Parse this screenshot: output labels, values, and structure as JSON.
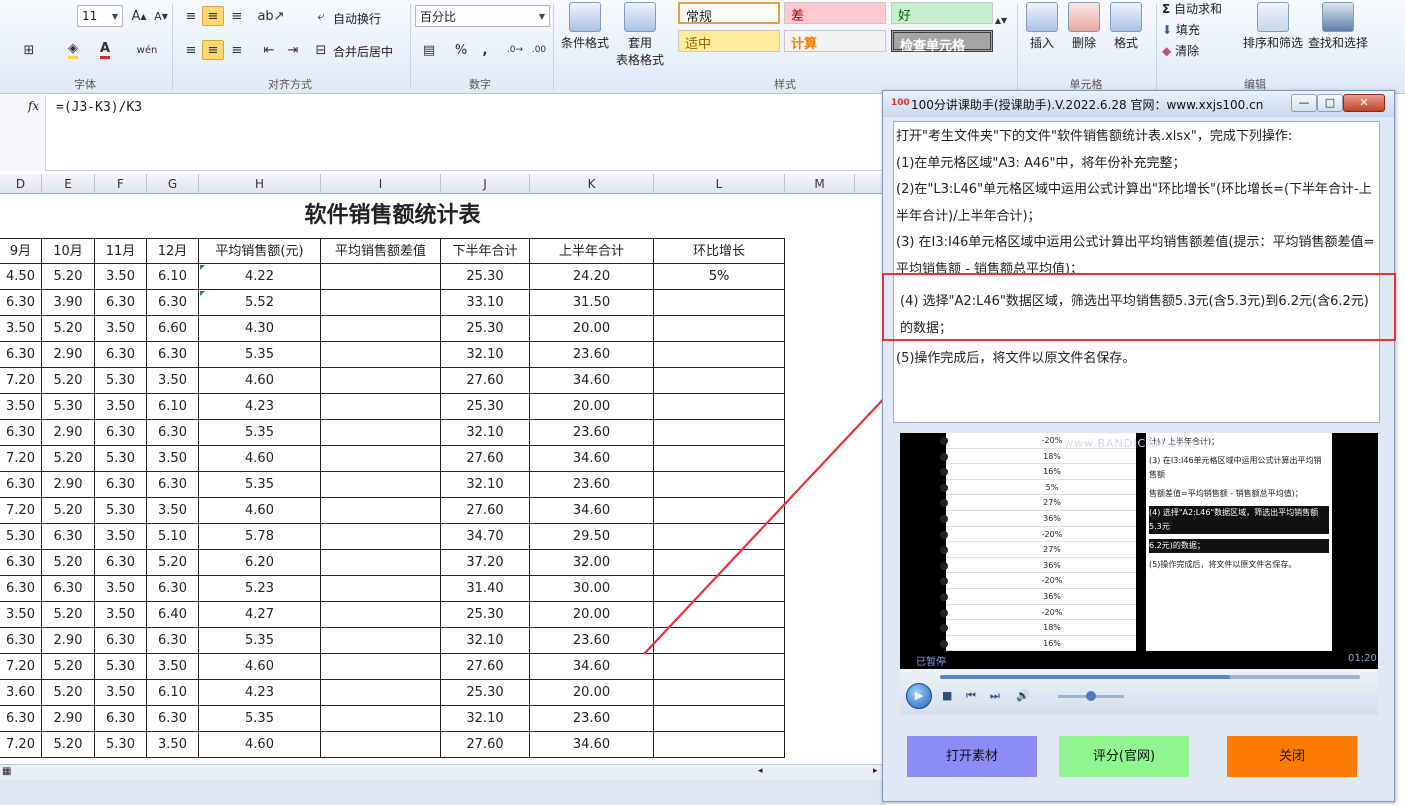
{
  "ribbon": {
    "font_size": "11",
    "font_color": "#e0242a",
    "fill_color": "#ffd23f",
    "wrap_label": "自动换行",
    "merge_label": "合并后居中",
    "number_format": "百分比",
    "percent_symbol": "%",
    "comma_symbol": ",",
    "cond_format_label": "条件格式",
    "table_format_label_1": "套用",
    "table_format_label_2": "表格格式",
    "styles": {
      "normal": "常规",
      "bad": "差",
      "good": "好",
      "neutral": "适中",
      "calc": "计算",
      "check": "检查单元格"
    },
    "insert_label": "插入",
    "delete_label": "删除",
    "format_label": "格式",
    "autosum_label": "自动求和",
    "fill_label": "填充",
    "clear_label": "清除",
    "sort_filter_label": "排序和筛选",
    "find_select_label": "查找和选择",
    "groups": {
      "font": "字体",
      "alignment": "对齐方式",
      "number": "数字",
      "styles": "样式",
      "cells": "单元格",
      "editing": "编辑"
    }
  },
  "formula_bar": {
    "fx": "fx",
    "formula": "=(J3-K3)/K3"
  },
  "sheet": {
    "columns": [
      {
        "letter": "D",
        "w": 42
      },
      {
        "letter": "E",
        "w": 53
      },
      {
        "letter": "F",
        "w": 52
      },
      {
        "letter": "G",
        "w": 52
      },
      {
        "letter": "H",
        "w": 122
      },
      {
        "letter": "I",
        "w": 120
      },
      {
        "letter": "J",
        "w": 89
      },
      {
        "letter": "K",
        "w": 124
      },
      {
        "letter": "L",
        "w": 131
      },
      {
        "letter": "M",
        "w": 70
      }
    ],
    "title": "软件销售额统计表",
    "headers": [
      "9月",
      "10月",
      "11月",
      "12月",
      "平均销售额(元)",
      "平均销售额差值",
      "下半年合计",
      "上半年合计",
      "环比增长"
    ],
    "rows": [
      [
        "4.50",
        "5.20",
        "3.50",
        "6.10",
        "4.22",
        "",
        "25.30",
        "24.20",
        "5%"
      ],
      [
        "6.30",
        "3.90",
        "6.30",
        "6.30",
        "5.52",
        "",
        "33.10",
        "31.50",
        ""
      ],
      [
        "3.50",
        "5.20",
        "3.50",
        "6.60",
        "4.30",
        "",
        "25.30",
        "20.00",
        ""
      ],
      [
        "6.30",
        "2.90",
        "6.30",
        "6.30",
        "5.35",
        "",
        "32.10",
        "23.60",
        ""
      ],
      [
        "7.20",
        "5.20",
        "5.30",
        "3.50",
        "4.60",
        "",
        "27.60",
        "34.60",
        ""
      ],
      [
        "3.50",
        "5.30",
        "3.50",
        "6.10",
        "4.23",
        "",
        "25.30",
        "20.00",
        ""
      ],
      [
        "6.30",
        "2.90",
        "6.30",
        "6.30",
        "5.35",
        "",
        "32.10",
        "23.60",
        ""
      ],
      [
        "7.20",
        "5.20",
        "5.30",
        "3.50",
        "4.60",
        "",
        "27.60",
        "34.60",
        ""
      ],
      [
        "6.30",
        "2.90",
        "6.30",
        "6.30",
        "5.35",
        "",
        "32.10",
        "23.60",
        ""
      ],
      [
        "7.20",
        "5.20",
        "5.30",
        "3.50",
        "4.60",
        "",
        "27.60",
        "34.60",
        ""
      ],
      [
        "5.30",
        "6.30",
        "3.50",
        "5.10",
        "5.78",
        "",
        "34.70",
        "29.50",
        ""
      ],
      [
        "6.30",
        "5.20",
        "6.30",
        "5.20",
        "6.20",
        "",
        "37.20",
        "32.00",
        ""
      ],
      [
        "6.30",
        "6.30",
        "3.50",
        "6.30",
        "5.23",
        "",
        "31.40",
        "30.00",
        ""
      ],
      [
        "3.50",
        "5.20",
        "3.50",
        "6.40",
        "4.27",
        "",
        "25.30",
        "20.00",
        ""
      ],
      [
        "6.30",
        "2.90",
        "6.30",
        "6.30",
        "5.35",
        "",
        "32.10",
        "23.60",
        ""
      ],
      [
        "7.20",
        "5.20",
        "5.30",
        "3.50",
        "4.60",
        "",
        "27.60",
        "34.60",
        ""
      ],
      [
        "3.60",
        "5.20",
        "3.50",
        "6.10",
        "4.23",
        "",
        "25.30",
        "20.00",
        ""
      ],
      [
        "6.30",
        "2.90",
        "6.30",
        "6.30",
        "5.35",
        "",
        "32.10",
        "23.60",
        ""
      ],
      [
        "7.20",
        "5.20",
        "5.30",
        "3.50",
        "4.60",
        "",
        "27.60",
        "34.60",
        ""
      ]
    ]
  },
  "helper": {
    "title": "100分讲课助手(授课助手).V.2022.6.28  官网：www.xxjs100.cn",
    "logo": "100",
    "paragraphs": [
      "打开\"考生文件夹\"下的文件\"软件销售额统计表.xlsx\"，完成下列操作:",
      "(1)在单元格区域\"A3: A46\"中，将年份补充完整；",
      "(2)在\"L3:L46\"单元格区域中运用公式计算出\"环比增长\"(环比增长=(下半年合计-上半年合计)/上半年合计)；",
      "(3) 在I3:I46单元格区域中运用公式计算出平均销售额差值(提示：平均销售额差值=平均销售额 - 销售额总平均值)；",
      "(4)  选择\"A2:L46\"数据区域，筛选出平均销售额5.3元(含5.3元)到6.2元(含6.2元)的数据；",
      "(5)操作完成后，将文件以原文件名保存。"
    ],
    "video": {
      "watermark": "www.BANDICAM.com",
      "left_values": [
        "-20%",
        "18%",
        "16%",
        "5%",
        "27%",
        "36%",
        "-20%",
        "27%",
        "36%",
        "-20%",
        "36%",
        "-20%",
        "18%",
        "16%"
      ],
      "right_lines": [
        "计) / 上半年合计)；",
        "(3) 在I3:I46单元格区域中运用公式计算出平均销售额",
        "售额差值=平均销售额 - 销售额总平均值)；",
        "(4) 选择\"A2:L46\"数据区域，筛选出平均销售额5.3元",
        "6.2元)的数据；",
        "(5)操作完成后，将文件以原文件名保存。"
      ],
      "status": "已暂停",
      "time": "01:20",
      "progress": 0.69,
      "volume": 0.5
    },
    "buttons": {
      "open": "打开素材",
      "score": "评分(官网)",
      "close": "关闭"
    },
    "colors": {
      "open_btn": "#8b8cf6",
      "score_btn": "#8ff58f",
      "close_btn": "#ff7b00",
      "highlight": "#e8323c"
    }
  }
}
